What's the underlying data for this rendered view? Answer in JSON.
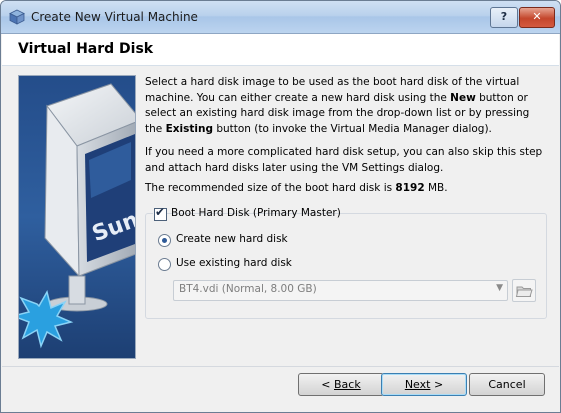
{
  "window": {
    "title": "Create New Virtual Machine",
    "help_label": "?",
    "close_label": "✕"
  },
  "page": {
    "heading": "Virtual Hard Disk"
  },
  "intro": {
    "p1_a": "Select a hard disk image to be used as the boot hard disk of the virtual machine. You can either create a new hard disk using the ",
    "p1_new": "New",
    "p1_b": " button or select an existing hard disk image from the drop-down list or by pressing the ",
    "p1_existing": "Existing",
    "p1_c": " button (to invoke the Virtual Media Manager dialog).",
    "p2": "If you need a more complicated hard disk setup, you can also skip this step and attach hard disks later using the VM Settings dialog.",
    "p3_a": "The recommended size of the boot hard disk is ",
    "p3_size": "8192",
    "p3_b": " MB."
  },
  "boot_disk": {
    "label": "Boot Hard Disk (Primary Master)",
    "checked": true,
    "option_create": "Create new hard disk",
    "option_existing": "Use existing hard disk",
    "selected_option": "create",
    "existing_value": "BT4.vdi (Normal, 8.00 GB)"
  },
  "buttons": {
    "back_prefix": "< ",
    "back_label": "Back",
    "next_label": "Next",
    "next_suffix": " >",
    "cancel_label": "Cancel"
  },
  "icons": {
    "title": "virtualbox-icon",
    "side": "virtualbox-logo-image",
    "folder": "open-folder-icon",
    "combo": "chevron-down-icon"
  },
  "colors": {
    "brand_blue": "#1f3f78",
    "star_blue": "#2aa0e0",
    "focus_border": "#3c7fb1"
  }
}
